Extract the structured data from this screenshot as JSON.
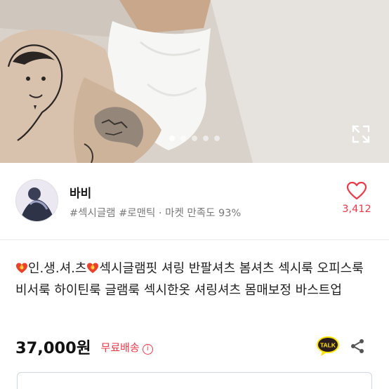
{
  "hero": {
    "icon": "product-photo",
    "carousel": {
      "total": 5,
      "active": 1
    },
    "expand_icon": "expand-icon"
  },
  "seller": {
    "name": "바비",
    "tags": "#섹시글램 #로맨틱 · 마켓 만족도 93%",
    "favorite_count": "3,412",
    "favorite_icon": "heart-icon"
  },
  "product": {
    "title_emoji": "heart-on-fire-icon",
    "title_part1": "인.생.셔.츠",
    "title_part2": "섹시글램핏 셔링 반팔셔츠 봄셔츠 섹시룩 오피스룩 비서룩 하이틴룩 글램룩 섹시한옷 셔링셔츠 몸매보정 바스트업",
    "price": "37,000원",
    "shipping": "무료배송",
    "info_icon_glyph": "i",
    "talk_label": "TALK"
  },
  "colors": {
    "accent_red": "#ea3a4a",
    "talk_yellow": "#fee500"
  }
}
